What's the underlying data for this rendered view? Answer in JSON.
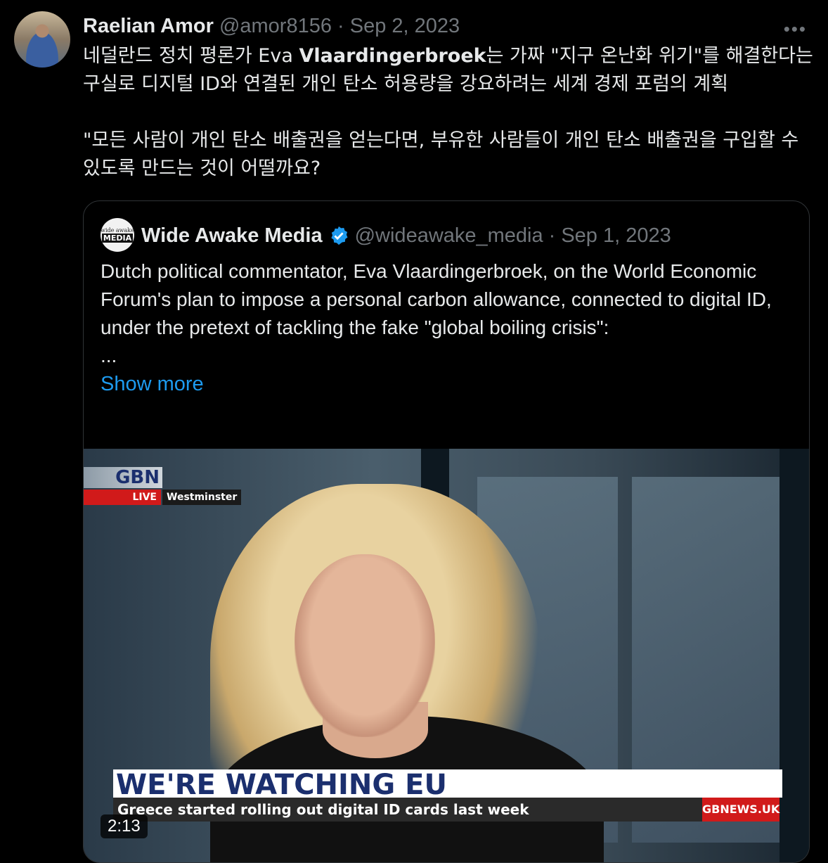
{
  "tweet": {
    "display_name": "Raelian Amor",
    "handle": "@amor8156",
    "separator": "·",
    "date": "Sep 2, 2023",
    "more_icon": "more-horizontal-icon",
    "text_line1_prefix": "네덜란드 정치 평론가 Eva ",
    "text_line1_bold": "Vlaardingerbroek",
    "text_line1_suffix": "는 가짜 \"지구 온난화 위기\"를 해결한다는 구실로 디지털 ID와 연결된 개인 탄소 허용량을 강요하려는 세계 경제 포럼의 계획",
    "text_paragraph2": "\"모든 사람이 개인 탄소 배출권을 얻는다면, 부유한 사람들이 개인 탄소 배출권을 구입할 수 있도록 만드는 것이 어떨까요?"
  },
  "quote": {
    "avatar_text_top": "wide awake",
    "avatar_text_bottom": "MEDIA",
    "display_name": "Wide Awake Media",
    "verified_icon": "verified-badge-icon",
    "handle": "@wideawake_media",
    "separator": "·",
    "date": "Sep 1, 2023",
    "text": "Dutch political commentator, Eva Vlaardingerbroek, on the World Economic Forum's plan to impose a personal carbon allowance, connected to digital ID, under the pretext of tackling the fake \"global boiling crisis\":",
    "ellipsis": "...",
    "show_more": "Show more",
    "video": {
      "channel_logo": "GBN",
      "live_label": "LIVE",
      "location": "Westminster",
      "headline": "WE'RE WATCHING EU",
      "ticker": "Greece started rolling out digital ID cards last week",
      "site": "GBNEWS.UK",
      "duration": "2:13"
    }
  },
  "colors": {
    "background": "#000000",
    "text": "#e7e9ea",
    "muted": "#71767b",
    "link": "#1d9bf0",
    "verified": "#1d9bf0",
    "border": "#2f3336"
  }
}
